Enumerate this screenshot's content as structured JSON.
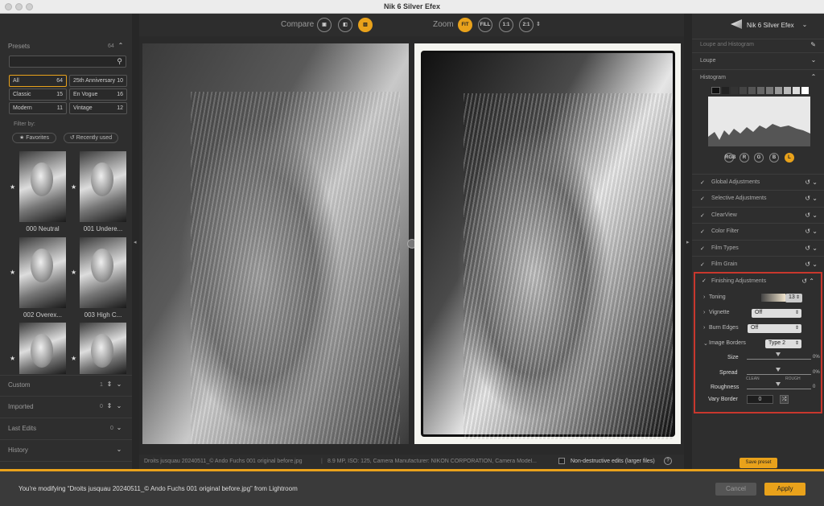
{
  "window": {
    "title": "Nik 6 Silver Efex"
  },
  "left": {
    "presets_label": "Presets",
    "presets_count": "64",
    "search_placeholder": "",
    "filters": [
      {
        "label": "All",
        "count": "64"
      },
      {
        "label": "25th Anniversary",
        "count": "10"
      },
      {
        "label": "Classic",
        "count": "15"
      },
      {
        "label": "En Vogue",
        "count": "16"
      },
      {
        "label": "Modern",
        "count": "11"
      },
      {
        "label": "Vintage",
        "count": "12"
      }
    ],
    "filter_by": "Filter by:",
    "favorites": "Favorites",
    "recently_used": "Recently used",
    "thumbs": [
      {
        "label": "000 Neutral"
      },
      {
        "label": "001 Undere..."
      },
      {
        "label": "002 Overex..."
      },
      {
        "label": "003 High C..."
      }
    ],
    "sections": [
      {
        "label": "Custom",
        "count": "1"
      },
      {
        "label": "Imported",
        "count": "0"
      },
      {
        "label": "Last Edits",
        "count": "0"
      },
      {
        "label": "History",
        "count": ""
      }
    ]
  },
  "toolbar": {
    "compare": "Compare",
    "zoom": "Zoom",
    "fit": "FIT",
    "fill": "FILL",
    "z11": "1:1",
    "z21": "2:1"
  },
  "status": {
    "filename": "Droits jusquau 20240511_© Ando Fuchs 001 original before.jpg",
    "meta": "8.9 MP, ISO: 125, Camera Manufacturer: NIKON CORPORATION, Camera Model...",
    "nondestructive": "Non-destructive edits (larger files)"
  },
  "right": {
    "brand": "Nik 6 Silver Efex",
    "loupe_hist": "Loupe and Histogram",
    "loupe": "Loupe",
    "histogram": "Histogram",
    "channels": [
      "RGB",
      "R",
      "G",
      "B",
      "L"
    ],
    "rows": [
      "Global Adjustments",
      "Selective Adjustments",
      "ClearView",
      "Color Filter",
      "Film Types",
      "Film Grain"
    ],
    "finishing": {
      "label": "Finishing Adjustments",
      "toning_label": "Toning",
      "toning_value": "13",
      "vignette_label": "Vignette",
      "vignette_value": "Off",
      "burn_label": "Burn Edges",
      "burn_value": "Off",
      "borders_label": "Image Borders",
      "borders_value": "Type 2",
      "size_label": "Size",
      "size_value": "0%",
      "spread_label": "Spread",
      "spread_value": "0%",
      "clean": "CLEAN",
      "rough": "ROUGH",
      "roughness_label": "Roughness",
      "roughness_value": "0",
      "vary_label": "Vary Border",
      "vary_value": "0"
    },
    "save_preset": "Save preset"
  },
  "bottom": {
    "message": "You're modifying “Droits jusquau 20240511_© Ando Fuchs 001 original before.jpg” from Lightroom",
    "cancel": "Cancel",
    "apply": "Apply"
  },
  "colors": {
    "accent": "#e9a21b",
    "highlight_box": "#c8372d"
  }
}
